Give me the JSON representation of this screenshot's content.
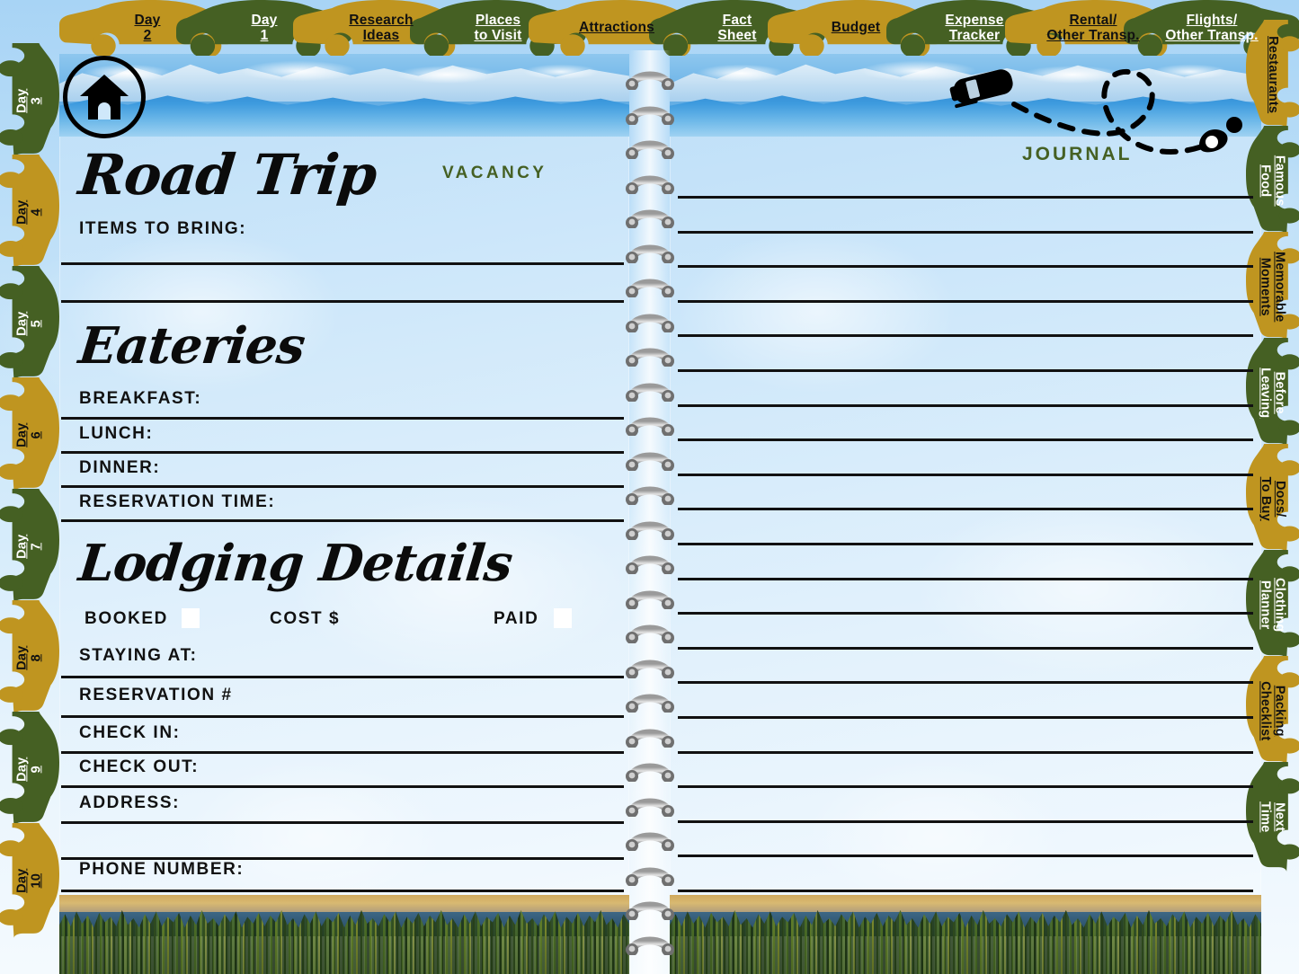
{
  "document": {
    "type": "road-trip-planner-spread",
    "left_page_title": "Road Trip",
    "right_page_title": "JOURNAL"
  },
  "colors": {
    "tab_gold": "#bf9520",
    "tab_green": "#456023",
    "green_text": "#456023",
    "line_black": "#111111",
    "page_blue": "#cfe8fa"
  },
  "home_button": {
    "icon": "home-icon",
    "label": "Home"
  },
  "top_tabs": [
    {
      "label": "Day\n2",
      "color": "gold"
    },
    {
      "label": "Day\n1",
      "color": "green"
    },
    {
      "label": "Research\nIdeas",
      "color": "gold"
    },
    {
      "label": "Places\nto Visit",
      "color": "green"
    },
    {
      "label": "Attractions",
      "color": "gold"
    },
    {
      "label": "Fact\nSheet",
      "color": "green"
    },
    {
      "label": "Budget",
      "color": "gold"
    },
    {
      "label": "Expense\nTracker",
      "color": "green"
    },
    {
      "label": "Rental/\nOther Transp.",
      "color": "gold"
    },
    {
      "label": "Flights/\nOther Transp.",
      "color": "green"
    }
  ],
  "left_tabs": [
    {
      "label": "Day\n3",
      "color": "green"
    },
    {
      "label": "Day\n4",
      "color": "gold"
    },
    {
      "label": "Day\n5",
      "color": "green"
    },
    {
      "label": "Day\n6",
      "color": "gold"
    },
    {
      "label": "Day\n7",
      "color": "green"
    },
    {
      "label": "Day\n8",
      "color": "gold"
    },
    {
      "label": "Day\n9",
      "color": "green"
    },
    {
      "label": "Day\n10",
      "color": "gold"
    }
  ],
  "right_tabs": [
    {
      "label": "Restaurants",
      "color": "gold"
    },
    {
      "label": "Famous\nFood",
      "color": "green"
    },
    {
      "label": "Memorable\nMoments",
      "color": "gold"
    },
    {
      "label": "Before\nLeaving",
      "color": "green"
    },
    {
      "label": "Docs/\nTo Buy",
      "color": "gold"
    },
    {
      "label": "Clothing\nPlanner",
      "color": "green"
    },
    {
      "label": "Packing\nChecklist",
      "color": "gold"
    },
    {
      "label": "Next\nTime",
      "color": "green"
    }
  ],
  "left_page": {
    "title": "Road Trip",
    "vacancy_stamp": "VACANCY",
    "items_to_bring_label": "ITEMS TO BRING:",
    "eateries_title": "Eateries",
    "eateries_fields": [
      "BREAKFAST:",
      "LUNCH:",
      "DINNER:",
      "RESERVATION TIME:"
    ],
    "lodging_title": "Lodging Details",
    "lodging_checks": [
      {
        "label": "BOOKED",
        "checked": false
      },
      {
        "label": "COST $",
        "checked": null
      },
      {
        "label": "PAID",
        "checked": false
      }
    ],
    "lodging_fields": [
      "STAYING AT:",
      "RESERVATION #",
      "CHECK IN:",
      "CHECK OUT:",
      "ADDRESS:",
      "PHONE NUMBER:"
    ],
    "header_photo": "snow-capped-mountain-range",
    "footer_photo": "boreal-forest-highway"
  },
  "right_page": {
    "title": "JOURNAL",
    "header_photo": "snow-capped-mountain-range",
    "footer_photo": "boreal-forest-highway",
    "doodle": "car-with-dashed-route-and-location-pin",
    "journal_line_count": 21
  }
}
